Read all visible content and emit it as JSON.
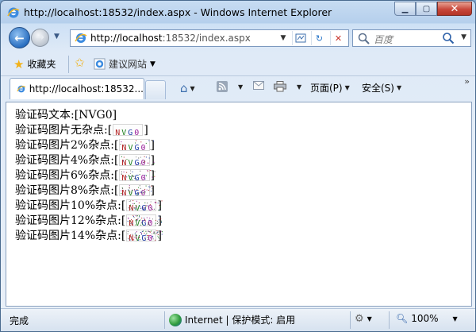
{
  "window": {
    "title": "http://localhost:18532/index.aspx - Windows Internet Explorer",
    "minimize_icon": "minimize-icon",
    "maximize_icon": "maximize-icon",
    "close_icon": "close-icon"
  },
  "nav": {
    "address_prefix": "http://localhost",
    "address_rest": ":18532/index.aspx",
    "search_placeholder": "百度"
  },
  "favorites": {
    "favorites_label": "收藏夹",
    "suggested_sites_label": "建议网站"
  },
  "tabs": {
    "active_tab_label": "http://localhost:18532..."
  },
  "commands": {
    "page_label": "页面(P)",
    "safety_label": "安全(S)"
  },
  "content": {
    "line1_label": "验证码文本:",
    "line1_value": "[NVG0]",
    "captcha_text": "NVG0",
    "lines": [
      {
        "label": "验证码图片无杂点:",
        "noise": 0
      },
      {
        "label": "验证码图片2%杂点:",
        "noise": 2
      },
      {
        "label": "验证码图片4%杂点:",
        "noise": 4
      },
      {
        "label": "验证码图片6%杂点:",
        "noise": 6
      },
      {
        "label": "验证码图片8%杂点:",
        "noise": 8
      },
      {
        "label": "验证码图片10%杂点:",
        "noise": 10
      },
      {
        "label": "验证码图片12%杂点:",
        "noise": 12
      },
      {
        "label": "验证码图片14%杂点:",
        "noise": 14
      }
    ],
    "bracket_open": "[",
    "bracket_close": "]"
  },
  "status": {
    "text": "完成",
    "zone": "Internet | 保护模式: 启用",
    "zoom": "100%"
  }
}
